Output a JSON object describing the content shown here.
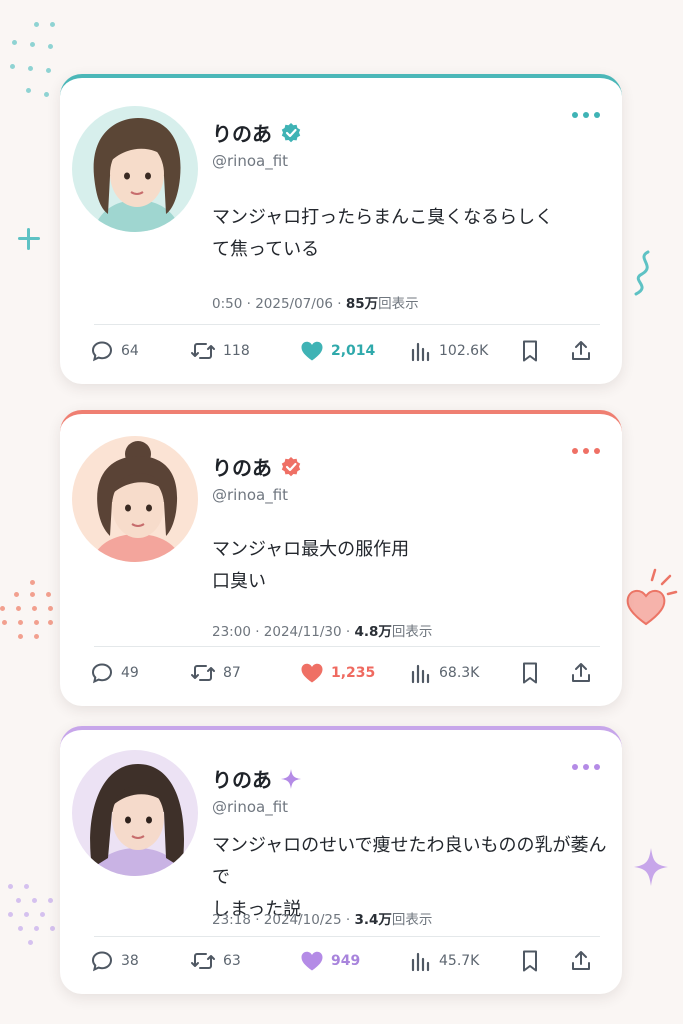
{
  "posts": [
    {
      "name": "りのあ",
      "handle": "@rinoa_fit",
      "text_lines": [
        "マンジャロ打ったらまんこ臭くなるらしく",
        "て焦っている"
      ],
      "time": "0:50 · 2025/07/06 · ",
      "views_label": "85万",
      "views_suffix": "回表示",
      "replies": "64",
      "reposts": "118",
      "likes": "2,014",
      "views": "102.6K",
      "accent": "#3fb3b5",
      "badge": "check-badge-icon"
    },
    {
      "name": "りのあ",
      "handle": "@rinoa_fit",
      "text_lines": [
        "マンジャロ最大の服作用",
        "口臭い"
      ],
      "time": "23:00 · 2024/11/30 · ",
      "views_label": "4.8万",
      "views_suffix": "回表示",
      "replies": "49",
      "reposts": "87",
      "likes": "1,235",
      "views": "68.3K",
      "accent": "#ef7065",
      "badge": "check-badge-icon"
    },
    {
      "name": "りのあ",
      "handle": "@rinoa_fit",
      "text_lines": [
        "マンジャロのせいで痩せたわ良いものの乳が萎んで",
        "しまった説"
      ],
      "time": "23:18 · 2024/10/25 · ",
      "views_label": "3.4万",
      "views_suffix": "回表示",
      "replies": "38",
      "reposts": "63",
      "likes": "949",
      "views": "45.7K",
      "accent": "#b48be6",
      "badge": "sparkle-badge-icon"
    }
  ]
}
